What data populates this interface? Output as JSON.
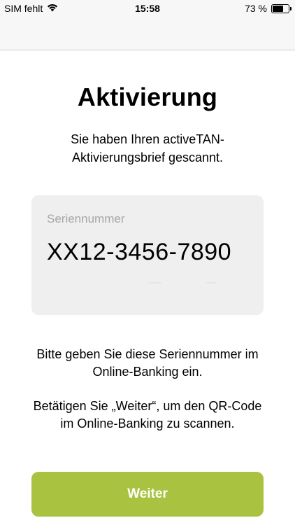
{
  "status_bar": {
    "carrier": "SIM fehlt",
    "wifi_icon": "wifi-icon",
    "time": "15:58",
    "battery_percent": "73 %",
    "battery_level": 0.73
  },
  "main": {
    "title": "Aktivierung",
    "subtitle": "Sie haben Ihren activeTAN-Aktivierungsbrief gescannt.",
    "serial": {
      "label": "Seriennummer",
      "value": "XX12-3456-7890"
    },
    "instruction_1": "Bitte geben Sie diese Seriennummer im Online-Banking ein.",
    "instruction_2": "Betätigen Sie „Weiter“, um den QR-Code im Online-Banking zu scannen."
  },
  "footer": {
    "continue_label": "Weiter"
  },
  "colors": {
    "accent": "#a9c23f",
    "card_background": "#efefef"
  }
}
